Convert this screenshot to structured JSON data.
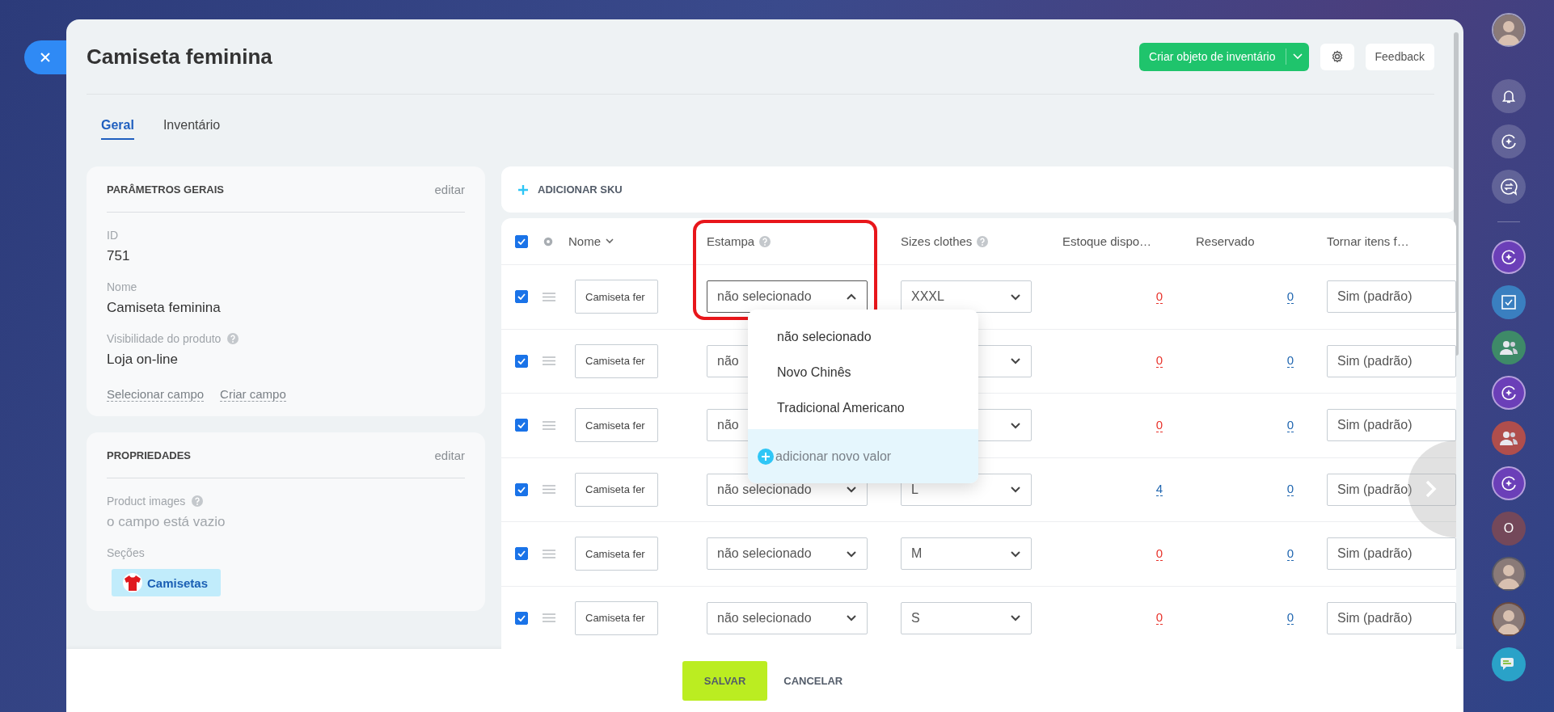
{
  "header": {
    "title": "Camiseta feminina",
    "create_button": "Criar objeto de inventário",
    "feedback_button": "Feedback"
  },
  "tabs": [
    {
      "label": "Geral",
      "selected": true
    },
    {
      "label": "Inventário",
      "selected": false
    }
  ],
  "general_card": {
    "title": "PARÂMETROS GERAIS",
    "edit": "editar",
    "fields": [
      {
        "label": "ID",
        "value": "751",
        "help": false
      },
      {
        "label": "Nome",
        "value": "Camiseta feminina",
        "help": false
      },
      {
        "label": "Visibilidade do produto",
        "value": "Loja on-line",
        "help": true
      }
    ],
    "links": [
      "Selecionar campo",
      "Criar campo"
    ]
  },
  "properties_card": {
    "title": "PROPRIEDADES",
    "edit": "editar",
    "fields": [
      {
        "label": "Product images",
        "value": "o campo está vazio",
        "help": true
      }
    ],
    "sections_label": "Seções",
    "section_chip": "Camisetas"
  },
  "add_sku": "ADICIONAR SKU",
  "table": {
    "all_checked": true,
    "columns": [
      {
        "label": "Nome",
        "sort": true,
        "help": false,
        "highlighted": false
      },
      {
        "label": "Estampa",
        "sort": false,
        "help": true,
        "highlighted": true
      },
      {
        "label": "Sizes clothes",
        "sort": false,
        "help": true,
        "highlighted": false
      },
      {
        "label": "Estoque dispo…",
        "sort": false,
        "help": false,
        "highlighted": false
      },
      {
        "label": "Reservado",
        "sort": false,
        "help": false,
        "highlighted": false
      },
      {
        "label": "Tornar itens f…",
        "sort": false,
        "help": false,
        "highlighted": false
      }
    ],
    "rows": [
      {
        "checked": true,
        "name": "Camiseta fer",
        "print": "não selecionado",
        "print_open": true,
        "print_covered": false,
        "size": "XXXL",
        "stock": {
          "value": "0",
          "color": "#e8332b"
        },
        "reserved": "0",
        "available": "Sim (padrão)"
      },
      {
        "checked": true,
        "name": "Camiseta fer",
        "print": "não",
        "print_open": false,
        "print_covered": true,
        "stock": {
          "value": "0",
          "color": "#e8332b"
        },
        "reserved": "0",
        "available": "Sim (padrão)"
      },
      {
        "checked": true,
        "name": "Camiseta fer",
        "print": "não",
        "print_open": false,
        "print_covered": true,
        "stock": {
          "value": "0",
          "color": "#e8332b"
        },
        "reserved": "0",
        "available": "Sim (padrão)"
      },
      {
        "checked": true,
        "name": "Camiseta fer",
        "print": "não selecionado",
        "print_open": false,
        "print_covered": false,
        "size": "L",
        "stock": {
          "value": "4",
          "color": "#2066b0"
        },
        "reserved": "0",
        "available": "Sim (padrão)"
      },
      {
        "checked": true,
        "name": "Camiseta fer",
        "print": "não selecionado",
        "print_open": false,
        "print_covered": false,
        "size": "M",
        "stock": {
          "value": "0",
          "color": "#e8332b"
        },
        "reserved": "0",
        "available": "Sim (padrão)"
      },
      {
        "checked": true,
        "name": "Camiseta fer",
        "print": "não selecionado",
        "print_open": false,
        "print_covered": false,
        "size": "S",
        "stock": {
          "value": "0",
          "color": "#e8332b"
        },
        "reserved": "0",
        "available": "Sim (padrão)"
      }
    ]
  },
  "dropdown": {
    "options": [
      "não selecionado",
      "Novo Chinês",
      "Tradicional Americano"
    ],
    "add_value": "adicionar novo valor"
  },
  "footer": {
    "save": "SALVAR",
    "cancel": "CANCELAR"
  },
  "sidebar": {
    "top": [
      {
        "kind": "avatar"
      },
      {
        "kind": "bell"
      },
      {
        "kind": "copilot"
      },
      {
        "kind": "chat-arrows"
      }
    ],
    "apps": [
      {
        "kind": "copilot",
        "color": "#6b3fb8"
      },
      {
        "kind": "task",
        "color": "#3a7fc0"
      },
      {
        "kind": "group",
        "color": "#3e8a68"
      },
      {
        "kind": "copilot",
        "color": "#6b3fb8"
      },
      {
        "kind": "group",
        "color": "#b04e4c"
      },
      {
        "kind": "copilot",
        "color": "#6b3fb8"
      },
      {
        "kind": "letter",
        "color": "#74485a",
        "text": "O"
      },
      {
        "kind": "avatar",
        "color": "#5a5a66"
      },
      {
        "kind": "avatar",
        "color": "#6a4a40"
      },
      {
        "kind": "chat",
        "color": "#2aa2c8"
      }
    ]
  }
}
